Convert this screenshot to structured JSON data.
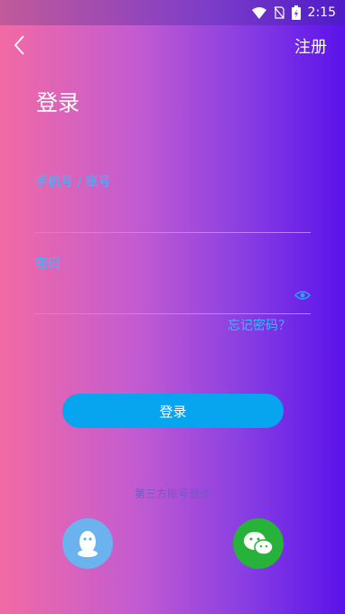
{
  "status_bar": {
    "time": "2:15"
  },
  "header": {
    "register_label": "注册"
  },
  "main": {
    "title": "登录",
    "phone": {
      "label": "手机号 / 账号",
      "value": "",
      "placeholder": ""
    },
    "password": {
      "label": "密码",
      "value": "",
      "placeholder": ""
    },
    "forgot_label": "忘记密码？",
    "login_label": "登录",
    "third_party_label": "第三方账号登录"
  },
  "icons": {
    "back": "chevron-left-icon",
    "show_password": "eye-icon",
    "qq": "qq-icon",
    "wechat": "wechat-icon"
  },
  "colors": {
    "accent": "#3fb6ff",
    "button": "#07a4ef",
    "qq": "#6ab3ee",
    "wechat": "#27b239"
  }
}
